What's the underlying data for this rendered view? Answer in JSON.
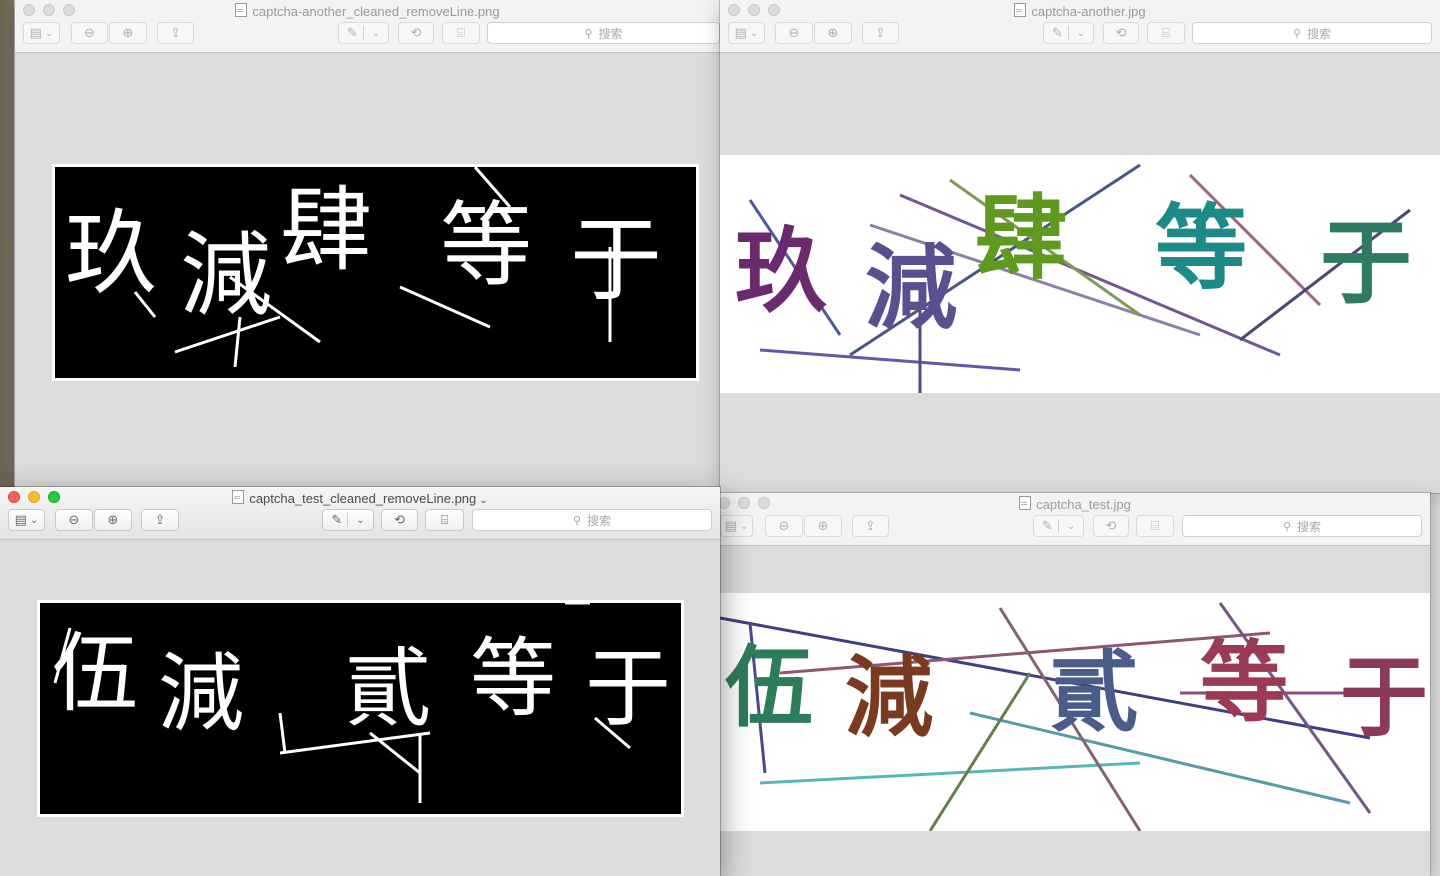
{
  "windows": {
    "top_left": {
      "title": "captcha-another_cleaned_removeLine.png",
      "search_placeholder": "搜索"
    },
    "top_right": {
      "title": "captcha-another.jpg",
      "search_placeholder": "搜索"
    },
    "bottom_left": {
      "title": "captcha_test_cleaned_removeLine.png",
      "search_placeholder": "搜索"
    },
    "bottom_right": {
      "title": "captcha_test.jpg",
      "search_placeholder": "搜索"
    }
  },
  "captcha_another": {
    "chars": [
      "玖",
      "減",
      "肆",
      "等",
      "于"
    ]
  },
  "captcha_test": {
    "chars": [
      "伍",
      "減",
      "貳",
      "等",
      "于"
    ]
  },
  "icons": {
    "sidebar": "sidebar-icon",
    "zoom_out": "zoom-out-icon",
    "zoom_in": "zoom-in-icon",
    "share": "share-icon",
    "markup": "markup-pen-icon",
    "rotate": "rotate-icon",
    "toolbox": "toolbox-icon",
    "search": "search-icon"
  },
  "colors": {
    "close": "#fc5f57",
    "minimize": "#fdbc2e",
    "zoom": "#28c840",
    "char1_another": "#6b2a6e",
    "char2_another": "#5a4f8f",
    "char3_another": "#5f9a1e",
    "char4_another": "#1c8a86",
    "char5_another": "#2f7a62",
    "char1_test": "#2e7d5a",
    "char2_test": "#7a3a20",
    "char3_test": "#4a5d8a",
    "char4_test": "#9a3a55",
    "char5_test": "#8a3a5a"
  }
}
